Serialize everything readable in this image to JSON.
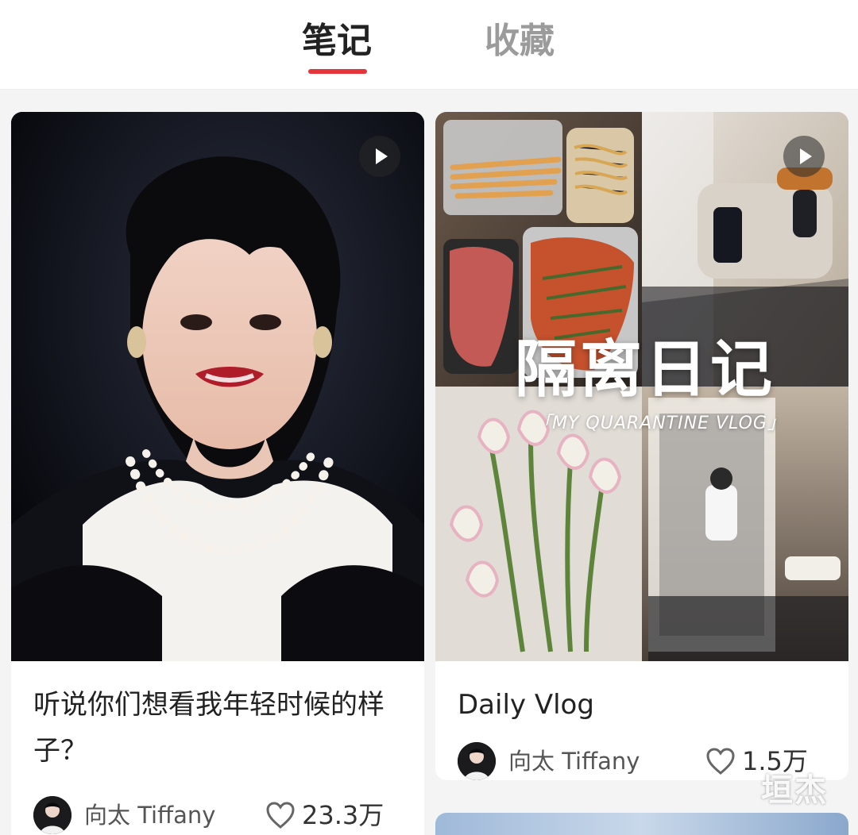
{
  "tabs": {
    "notes": "笔记",
    "collections": "收藏"
  },
  "colors": {
    "accent": "#e6343b",
    "tab_active_text": "#222222",
    "tab_inactive_text": "#9b9b9b",
    "background": "#f4f4f5"
  },
  "feed": [
    {
      "title": "听说你们想看我年轻时候的样子？",
      "author": "向太 Tiffany",
      "likes": "23.3万",
      "media_icon": "play-icon"
    },
    {
      "title": "Daily Vlog",
      "author": "向太 Tiffany",
      "likes": "1.5万",
      "media_icon": "play-icon",
      "overlay_title": "隔离日记",
      "overlay_subtitle": "「MY QUARANTINE VLOG」"
    }
  ],
  "watermark": "垣杰"
}
